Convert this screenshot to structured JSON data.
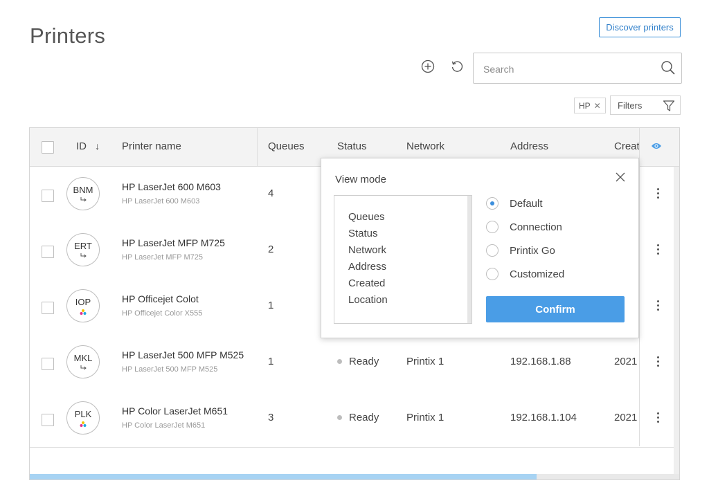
{
  "header": {
    "title": "Printers",
    "discover_label": "Discover printers"
  },
  "toolbar": {
    "search_placeholder": "Search",
    "active_filter_chip": "HP",
    "filters_label": "Filters"
  },
  "table": {
    "columns": {
      "id": "ID",
      "printer_name": "Printer name",
      "queues": "Queues",
      "status": "Status",
      "network": "Network",
      "address": "Address",
      "created": "Creat"
    },
    "rows": [
      {
        "id": "BNM",
        "name": "HP LaserJet 600 M603",
        "model": "HP LaserJet 600 M603",
        "queues": "4",
        "status": "",
        "network": "",
        "address": "",
        "created": "",
        "icon": "redirect-icon"
      },
      {
        "id": "ERT",
        "name": "HP LaserJet MFP M725",
        "model": "HP LaserJet MFP M725",
        "queues": "2",
        "status": "",
        "network": "",
        "address": "",
        "created": "",
        "icon": "redirect-icon"
      },
      {
        "id": "IOP",
        "name": "HP Officejet Colot",
        "model": "HP Officejet Color X555",
        "queues": "1",
        "status": "",
        "network": "",
        "address": "",
        "created": "",
        "icon": "color-drops-icon"
      },
      {
        "id": "MKL",
        "name": "HP LaserJet 500 MFP M525",
        "model": "HP LaserJet 500 MFP M525",
        "queues": "1",
        "status": "Ready",
        "network": "Printix 1",
        "address": "192.168.1.88",
        "created": "2021",
        "icon": "redirect-icon"
      },
      {
        "id": "PLK",
        "name": "HP Color LaserJet M651",
        "model": "HP Color LaserJet M651",
        "queues": "3",
        "status": "Ready",
        "network": "Printix 1",
        "address": "192.168.1.104",
        "created": "2021",
        "icon": "color-drops-icon"
      }
    ]
  },
  "view_mode_popup": {
    "title": "View mode",
    "columns_list": [
      "Queues",
      "Status",
      "Network",
      "Address",
      "Created",
      "Location"
    ],
    "options": [
      "Default",
      "Connection",
      "Printix Go",
      "Customized"
    ],
    "selected_option": "Default",
    "confirm_label": "Confirm"
  },
  "colors": {
    "accent": "#4a9de6",
    "link": "#2f7fca",
    "scroll_thumb": "#a7d3f3"
  }
}
